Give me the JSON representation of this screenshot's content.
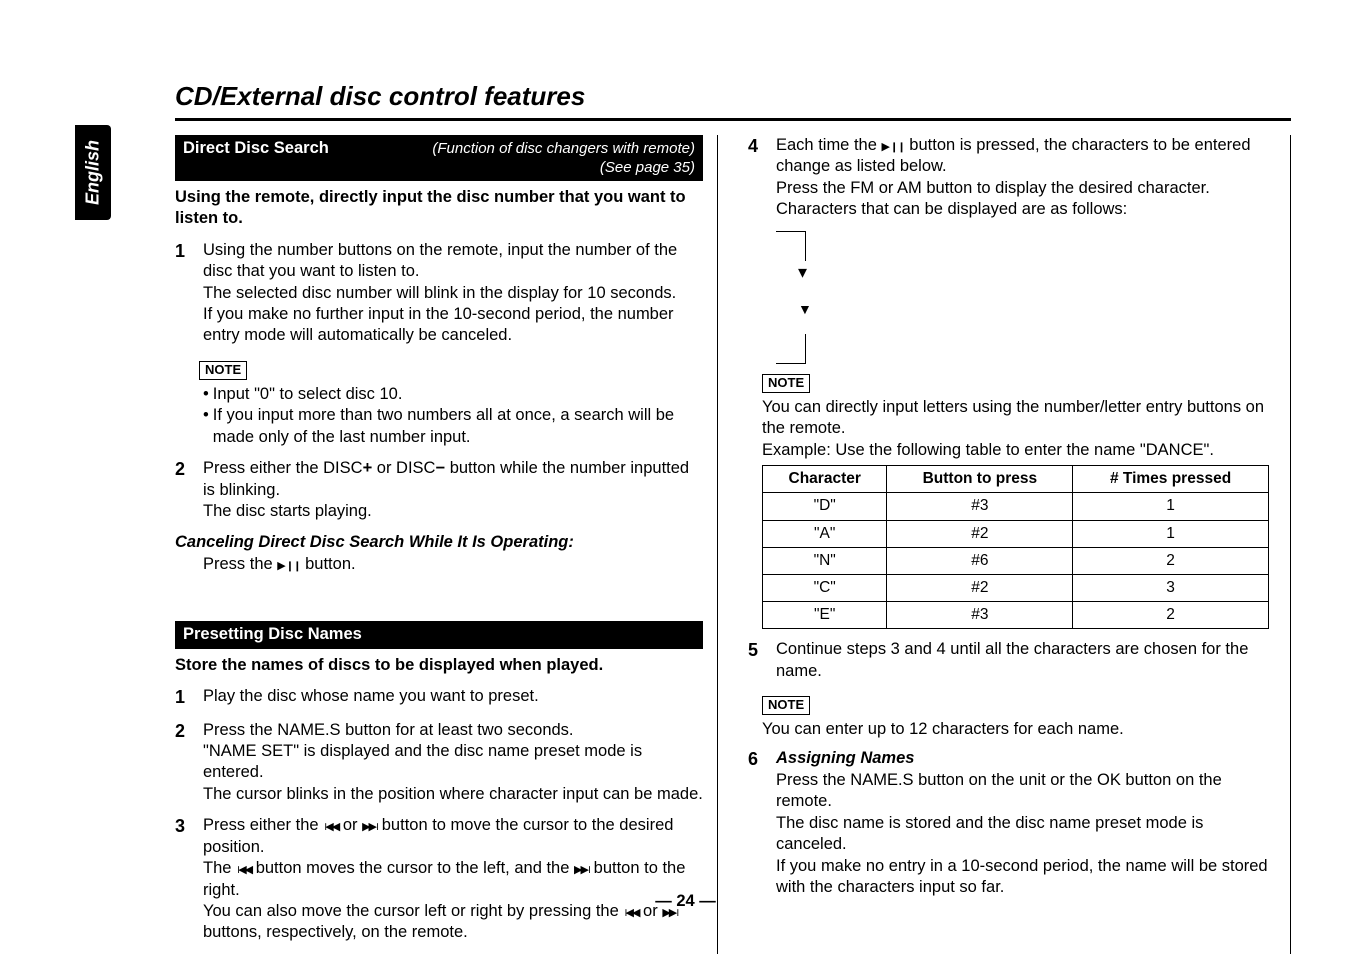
{
  "language_tab": "English",
  "page_title": "CD/External disc control features",
  "page_number": "24",
  "left": {
    "section1": {
      "bar_title": "Direct Disc Search",
      "bar_sub1": "(Function of disc changers with remote)",
      "bar_sub2": "(See page 35)",
      "intro": "Using the remote, directly input the disc number that you want to listen to.",
      "step1_a": "Using the number buttons on the remote, input the number of the disc that you want to listen to.",
      "step1_b": "The selected disc number will blink in the display for 10 seconds.",
      "step1_c": "If you make no further input in the 10-second period, the number entry mode will automatically be canceled.",
      "note_label": "NOTE",
      "bullet1": "Input \"0\" to select disc 10.",
      "bullet2": "If you input more than two numbers all at once, a search will be made only of the last number input.",
      "step2_a_pre": "Press either the DISC",
      "step2_a_plus": "+",
      "step2_a_mid": " or DISC",
      "step2_a_minus": "−",
      "step2_a_post": " button while the number inputted is blinking.",
      "step2_b": "The disc starts playing.",
      "cancel_head": "Canceling Direct Disc Search While It Is Operating:",
      "cancel_body_pre": "Press the ",
      "cancel_body_post": " button."
    },
    "section2": {
      "bar_title": "Presetting Disc Names",
      "intro": "Store the names of discs to be displayed when played.",
      "step1": "Play the disc whose name you want to preset.",
      "step2_a": "Press the NAME.S button for at least two seconds.",
      "step2_b": "\"NAME SET\" is displayed and the disc name preset mode is entered.",
      "step2_c": "The cursor blinks in the position where character input can be made.",
      "step3_a_pre": "Press either the ",
      "step3_a_mid": " or ",
      "step3_a_post": " button to move the cursor to the desired position.",
      "step3_b_pre": "The ",
      "step3_b_mid": " button moves the cursor to the left, and the ",
      "step3_b_post": " button to the right.",
      "step3_c_pre": "You can also move the cursor left or right by pressing the ",
      "step3_c_mid": " or ",
      "step3_c_post": " buttons, respectively, on the remote."
    }
  },
  "right": {
    "step4_a_pre": "Each time the ",
    "step4_a_post": " button is pressed, the characters to be entered change as listed below.",
    "step4_b": "Press the FM or AM button to display the desired character.",
    "step4_c": "Characters that can be displayed are as follows:",
    "note_label": "NOTE",
    "note4_a": "You can directly input letters using the number/letter entry buttons on the remote.",
    "note4_b": "Example: Use the following table to enter the name \"DANCE\".",
    "table": {
      "h1": "Character",
      "h2": "Button to press",
      "h3": "# Times pressed",
      "rows": [
        {
          "c": "\"D\"",
          "b": "#3",
          "t": "1"
        },
        {
          "c": "\"A\"",
          "b": "#2",
          "t": "1"
        },
        {
          "c": "\"N\"",
          "b": "#6",
          "t": "2"
        },
        {
          "c": "\"C\"",
          "b": "#2",
          "t": "3"
        },
        {
          "c": "\"E\"",
          "b": "#3",
          "t": "2"
        }
      ]
    },
    "step5": "Continue steps 3 and 4 until all the characters are chosen for the name.",
    "note5": "You can enter up to 12 characters for each name.",
    "step6_head": "Assigning Names",
    "step6_a": "Press the NAME.S button on the unit or the OK button on the remote.",
    "step6_b": "The disc name is stored and the disc name preset mode is canceled.",
    "step6_c": "If you make no entry in a 10-second period, the name will be stored with the characters input so far."
  }
}
